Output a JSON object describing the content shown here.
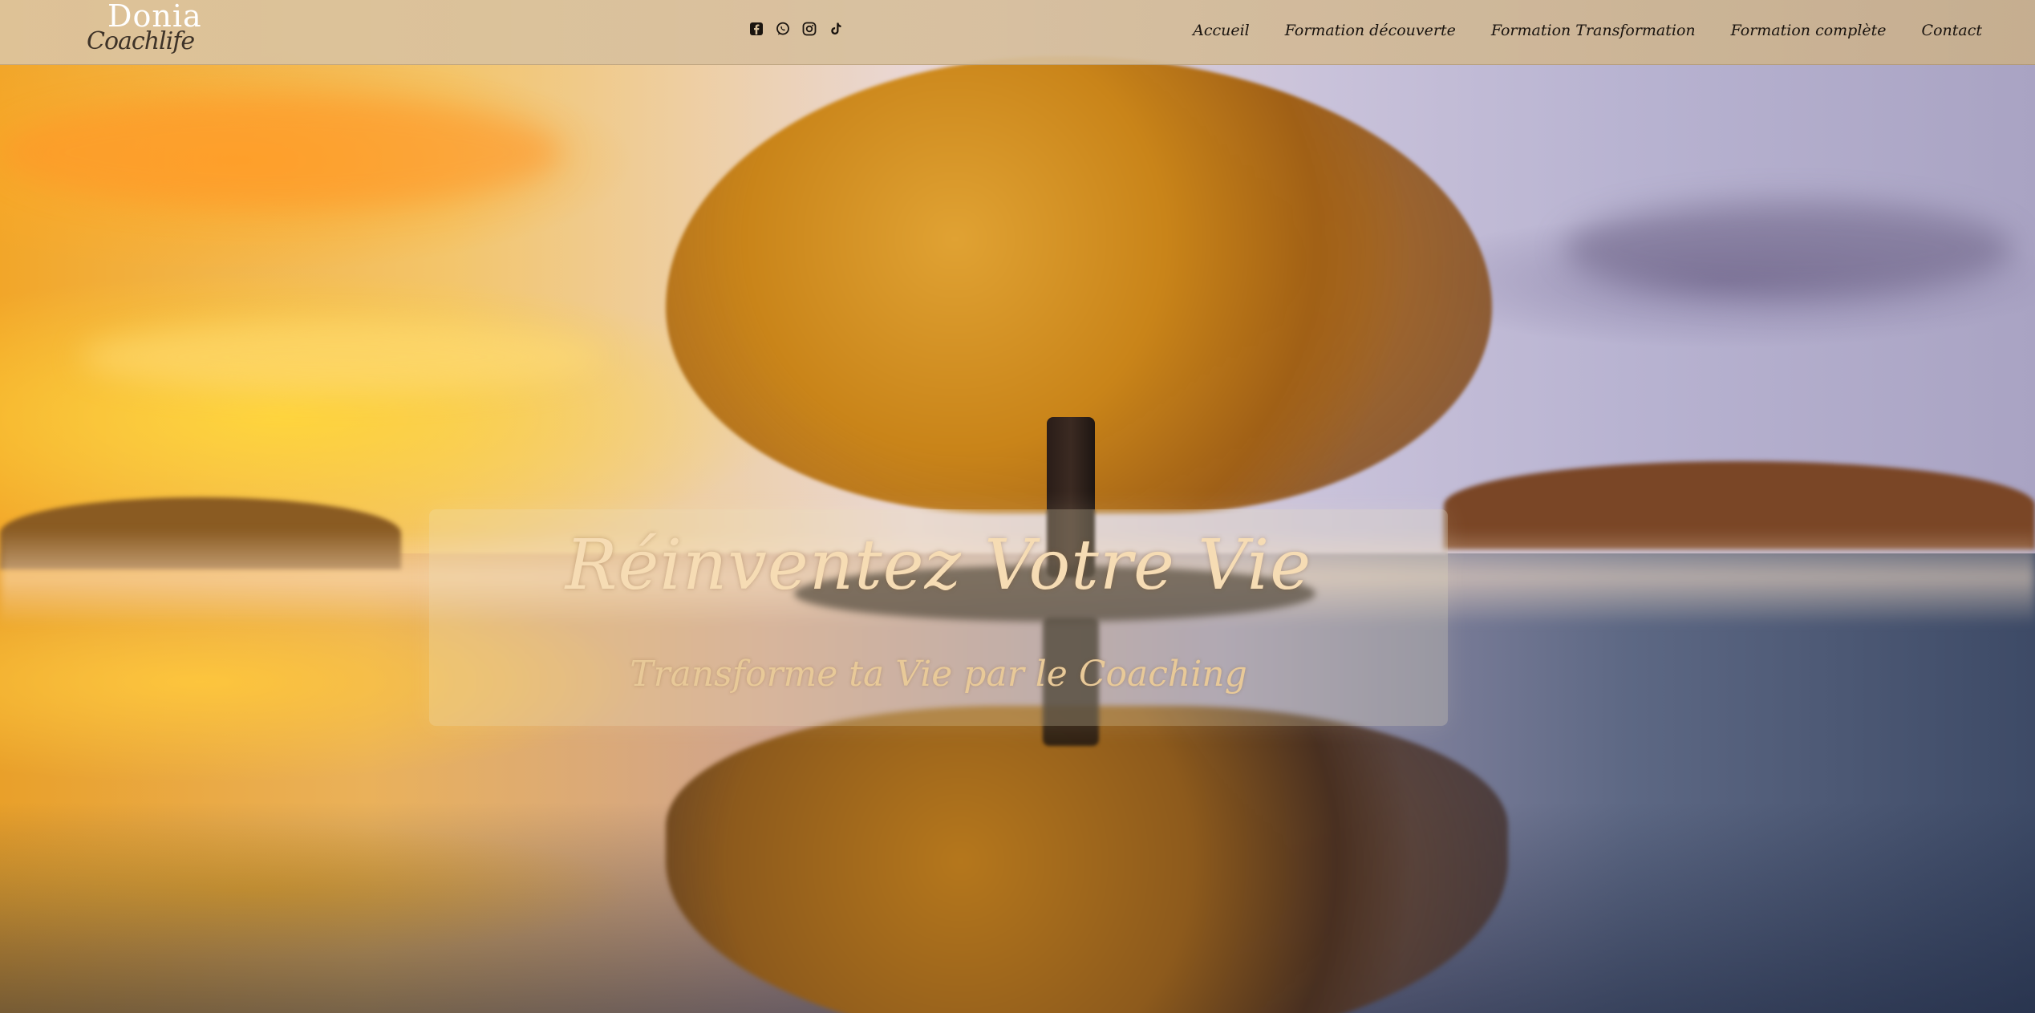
{
  "logo": {
    "word": "Donia",
    "script": "Coachlife"
  },
  "social": {
    "items": [
      {
        "icon": "facebook-icon"
      },
      {
        "icon": "whatsapp-icon"
      },
      {
        "icon": "instagram-icon"
      },
      {
        "icon": "tiktok-icon"
      }
    ]
  },
  "nav": {
    "items": [
      {
        "label": "Accueil"
      },
      {
        "label": "Formation découverte"
      },
      {
        "label": "Formation Transformation"
      },
      {
        "label": "Formation complète"
      },
      {
        "label": "Contact"
      }
    ]
  },
  "hero": {
    "title": "Réinventez Votre Vie",
    "subtitle": "Transforme ta Vie par le Coaching"
  },
  "colors": {
    "navbar": "#d8c19d",
    "nav_text": "#1a140f",
    "hero_title": "#f6dcb4",
    "hero_subtitle": "#e8c998"
  }
}
